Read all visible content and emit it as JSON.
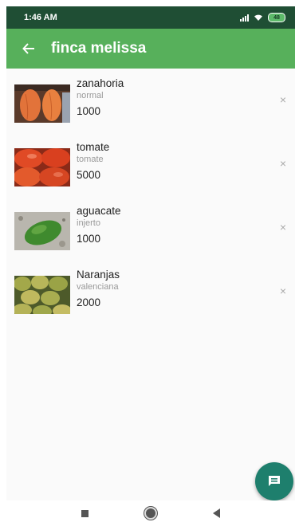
{
  "status_bar": {
    "time": "1:46 AM",
    "battery": "48"
  },
  "app_bar": {
    "back_icon": "arrow-left-icon",
    "title": "finca melissa"
  },
  "products": [
    {
      "name": "zanahoria",
      "variety": "normal",
      "quantity": "1000",
      "image": "carrot-photo"
    },
    {
      "name": "tomate",
      "variety": "tomate",
      "quantity": "5000",
      "image": "tomato-photo"
    },
    {
      "name": "aguacate",
      "variety": "injerto",
      "quantity": "1000",
      "image": "avocado-photo"
    },
    {
      "name": "Naranjas",
      "variety": "valenciana",
      "quantity": "2000",
      "image": "orange-photo"
    }
  ],
  "remove_glyph": "×",
  "fab": {
    "icon": "message-icon"
  },
  "colors": {
    "status_bar": "#1f4e34",
    "app_bar": "#57b05b",
    "fab": "#1e7f6d"
  }
}
